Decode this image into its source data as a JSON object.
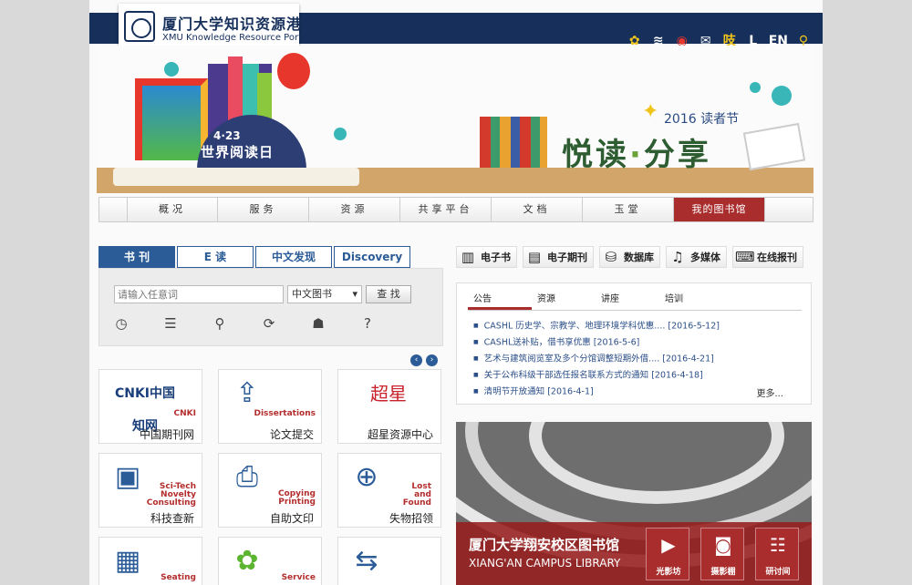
{
  "header": {
    "logo_cn": "厦门大学知识资源港",
    "logo_en": "XMU Knowledge Resource Portal",
    "icons": [
      "wechat-icon",
      "wifi-icon",
      "weibo-icon",
      "mail-icon",
      "chat-icon",
      "library-icon"
    ],
    "lang": "EN"
  },
  "banner": {
    "date": "4·23",
    "event": "世界阅读日",
    "year_label": "2016 读者节",
    "slogan_a": "悦读",
    "slogan_dot": "·",
    "slogan_b": "分享"
  },
  "nav": {
    "items": [
      "概况",
      "服务",
      "资源",
      "共享平台",
      "文档",
      "玉堂",
      "我的图书馆"
    ],
    "active": "我的图书馆"
  },
  "search": {
    "tabs": [
      "书 刊",
      "E 读",
      "中文发现",
      "Discovery"
    ],
    "placeholder": "请输入任意词",
    "select_value": "中文图书",
    "button": "查 找",
    "tool_icons": [
      "clock-icon",
      "list-icon",
      "location-icon",
      "refresh-icon",
      "user-icon",
      "help-icon"
    ]
  },
  "services": [
    {
      "en": "CNKI",
      "cn": "中国期刊网",
      "logo": "CNKI中国知网"
    },
    {
      "en": "Dissertations",
      "cn": "论文提交"
    },
    {
      "en": "",
      "cn": "超星资源中心",
      "logo": "超星"
    },
    {
      "en": "Sci-Tech Novelty Consulting",
      "cn": "科技查新"
    },
    {
      "en": "Copying Printing",
      "cn": "自助文印"
    },
    {
      "en": "Lost and Found",
      "cn": "失物招领"
    },
    {
      "en": "Seating",
      "cn": ""
    },
    {
      "en": "Service",
      "cn": ""
    },
    {
      "en": "",
      "cn": ""
    }
  ],
  "resources": [
    "电子书",
    "电子期刊",
    "数据库",
    "多媒体",
    "在线报刊"
  ],
  "notices": {
    "tabs": [
      "公告",
      "资源",
      "讲座",
      "培训"
    ],
    "active": "公告",
    "items": [
      "CASHL 历史学、宗教学、地理环境学科优惠.... [2016-5-12]",
      "CASHL送补贴，借书享优惠 [2016-5-6]",
      "艺术与建筑阅览室及多个分馆调整短期外借.... [2016-4-21]",
      "关于公布科级干部选任报名联系方式的通知 [2016-4-18]",
      "清明节开放通知 [2016-4-1]"
    ],
    "more": "更多..."
  },
  "photo": {
    "title_cn": "厦门大学翔安校区图书馆",
    "title_en": "XIANG'AN CAMPUS LIBRARY",
    "buttons": [
      "光影坊",
      "摄影棚",
      "研讨间"
    ]
  },
  "colors": {
    "navy": "#16305b",
    "accent_red": "#a92d2d",
    "link_blue": "#2b4f88",
    "tab_blue": "#2b5c97"
  }
}
